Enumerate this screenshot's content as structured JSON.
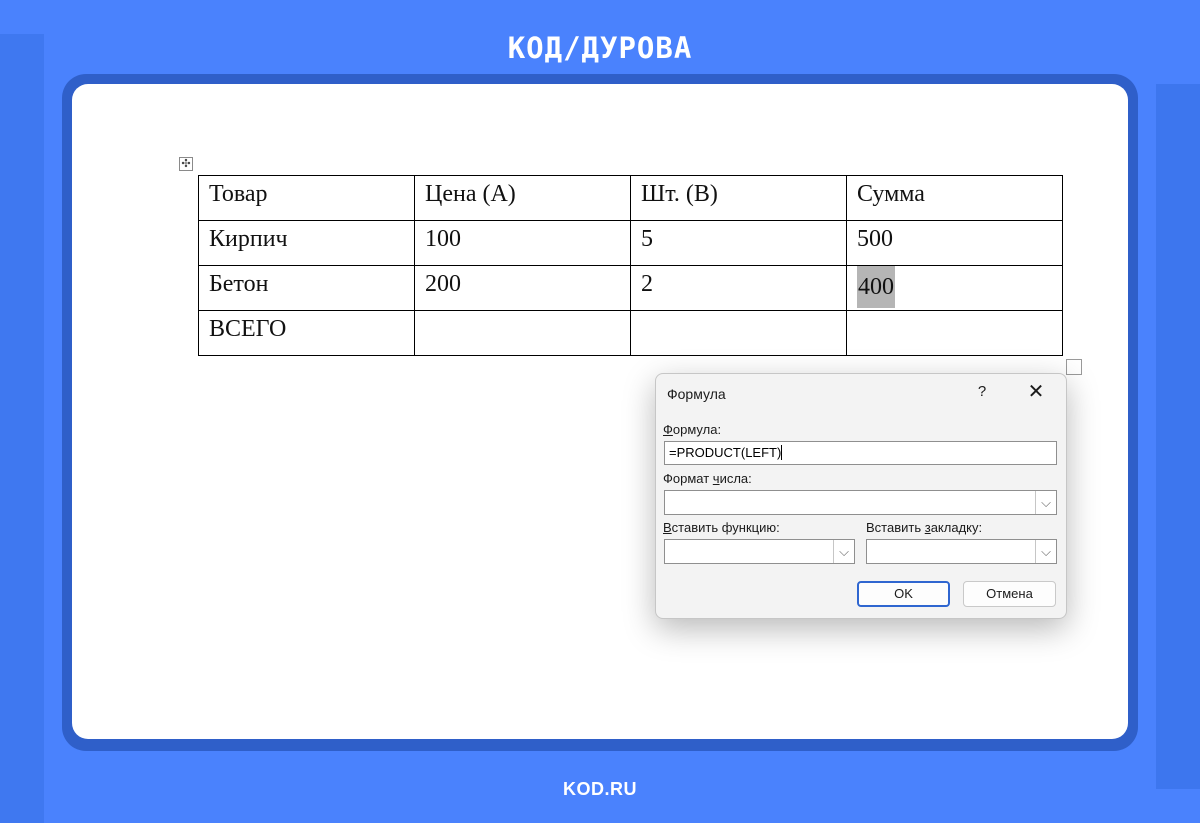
{
  "brand": "КОД/ДУРОВА",
  "footer": "KOD.RU",
  "table": {
    "rows": [
      [
        "Товар",
        "Цена (A)",
        "Шт. (B)",
        "Сумма"
      ],
      [
        "Кирпич",
        "100",
        "5",
        "500"
      ],
      [
        "Бетон",
        "200",
        "2",
        "400"
      ],
      [
        "ВСЕГО",
        "",
        "",
        ""
      ]
    ]
  },
  "dialog": {
    "title": "Формула",
    "help": "?",
    "close": "✕",
    "formula_label_ul": "Ф",
    "formula_label_rest": "ормула:",
    "formula_value": "=PRODUCT(LEFT)",
    "format_label_pre": "Формат ",
    "format_label_ul": "ч",
    "format_label_rest": "исла:",
    "format_value": "",
    "insert_function_label_ul": "В",
    "insert_function_label_rest": "ставить функцию:",
    "insert_function_value": "",
    "insert_bookmark_label_pre": "Вставить ",
    "insert_bookmark_label_ul": "з",
    "insert_bookmark_label_rest": "акладку:",
    "insert_bookmark_value": "",
    "ok": "OK",
    "cancel": "Отмена"
  }
}
